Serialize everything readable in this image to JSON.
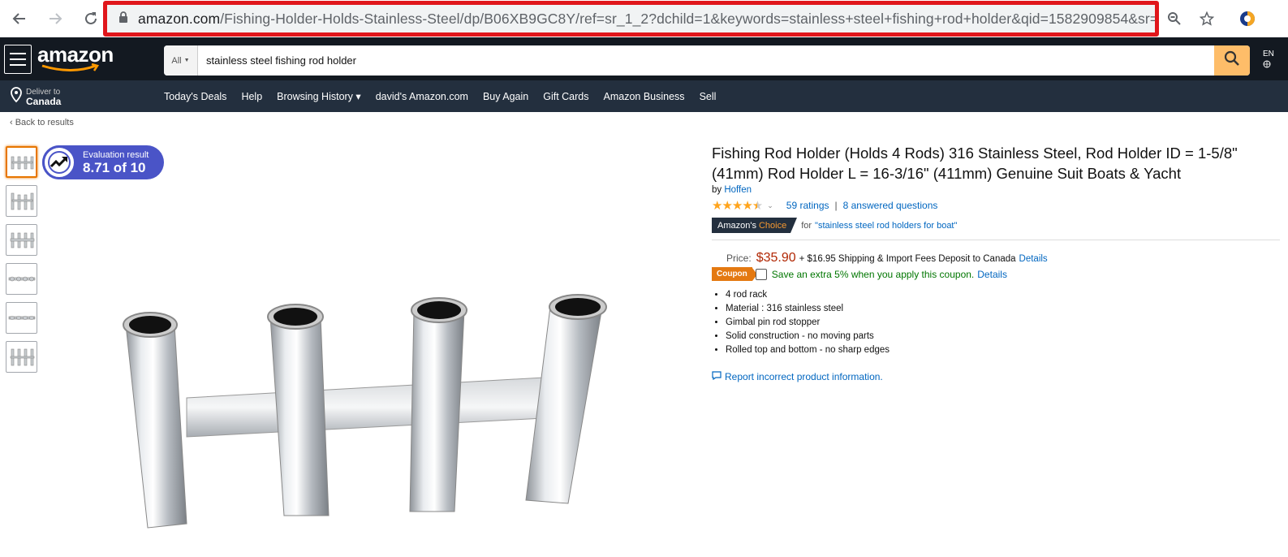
{
  "browser": {
    "url_host": "amazon.com",
    "url_path": "/Fishing-Holder-Holds-Stainless-Steel/dp/B06XB9GC8Y/ref=sr_1_2?dchild=1&keywords=stainless+steel+fishing+rod+holder&qid=1582909854&sr=..."
  },
  "header": {
    "logo": "amazon",
    "search_dept": "All",
    "search_value": "stainless steel fishing rod holder",
    "lang": "EN"
  },
  "nav": {
    "deliver_line1": "Deliver to",
    "deliver_line2": "Canada",
    "links": [
      "Today's Deals",
      "Help",
      "Browsing History ▾",
      "david's Amazon.com",
      "Buy Again",
      "Gift Cards",
      "Amazon Business",
      "Sell"
    ]
  },
  "page": {
    "back": "‹ Back to results",
    "eval_label": "Evaluation result",
    "eval_score": "8.71 of 10"
  },
  "product": {
    "title": "Fishing Rod Holder (Holds 4 Rods) 316 Stainless Steel, Rod Holder ID = 1-5/8\" (41mm) Rod Holder L = 16-3/16\" (411mm) Genuine Suit Boats & Yacht",
    "by": "by",
    "brand": "Hoffen",
    "ratings": "59 ratings",
    "separator": "|",
    "answered": "8 answered questions",
    "choice_label": "Amazon's",
    "choice_word": "Choice",
    "choice_for": "for",
    "choice_query": "\"stainless steel rod holders for boat\"",
    "price_label": "Price:",
    "price": "$35.90",
    "shipping": "+ $16.95 Shipping & Import Fees Deposit to Canada",
    "details": "Details",
    "coupon_tag": "Coupon",
    "coupon_text": "Save an extra 5% when you apply this coupon.",
    "coupon_details": "Details",
    "bullets": [
      "4 rod rack",
      "Material : 316 stainless steel",
      "Gimbal pin rod stopper",
      "Solid construction - no moving parts",
      "Rolled top and bottom - no sharp edges"
    ],
    "report": "Report incorrect product information.",
    "rating_value": 4.5
  }
}
